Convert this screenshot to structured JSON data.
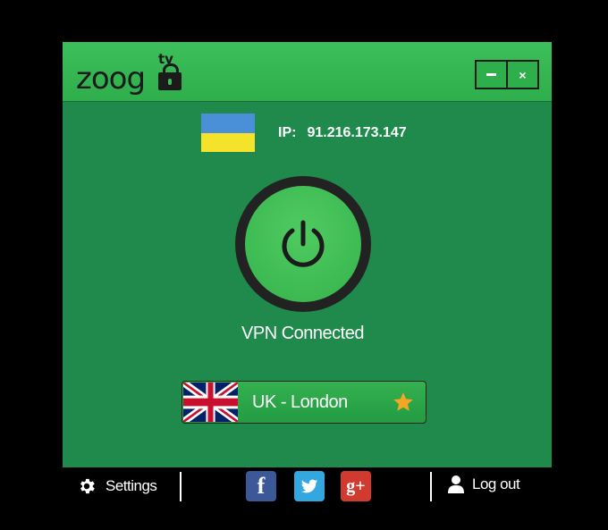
{
  "app": {
    "logo_text": "zoog",
    "logo_suffix": "tv"
  },
  "window_controls": {
    "minimize": "–",
    "close": "×"
  },
  "connection": {
    "ip_label": "IP:",
    "ip_value": "91.216.173.147",
    "status": "VPN Connected",
    "current_flag": "ukraine-flag"
  },
  "location": {
    "label": "UK - London",
    "flag": "uk-flag",
    "favorite": true
  },
  "footer": {
    "settings_label": "Settings",
    "logout_label": "Log out",
    "social": {
      "facebook": "f",
      "twitter": "twitter-bird",
      "googleplus": "g+"
    }
  },
  "colors": {
    "window_green": "#1f8a4b",
    "titlebar_green": "#3cbf5a",
    "power_green": "#37b24d",
    "star": "#f5a623"
  }
}
